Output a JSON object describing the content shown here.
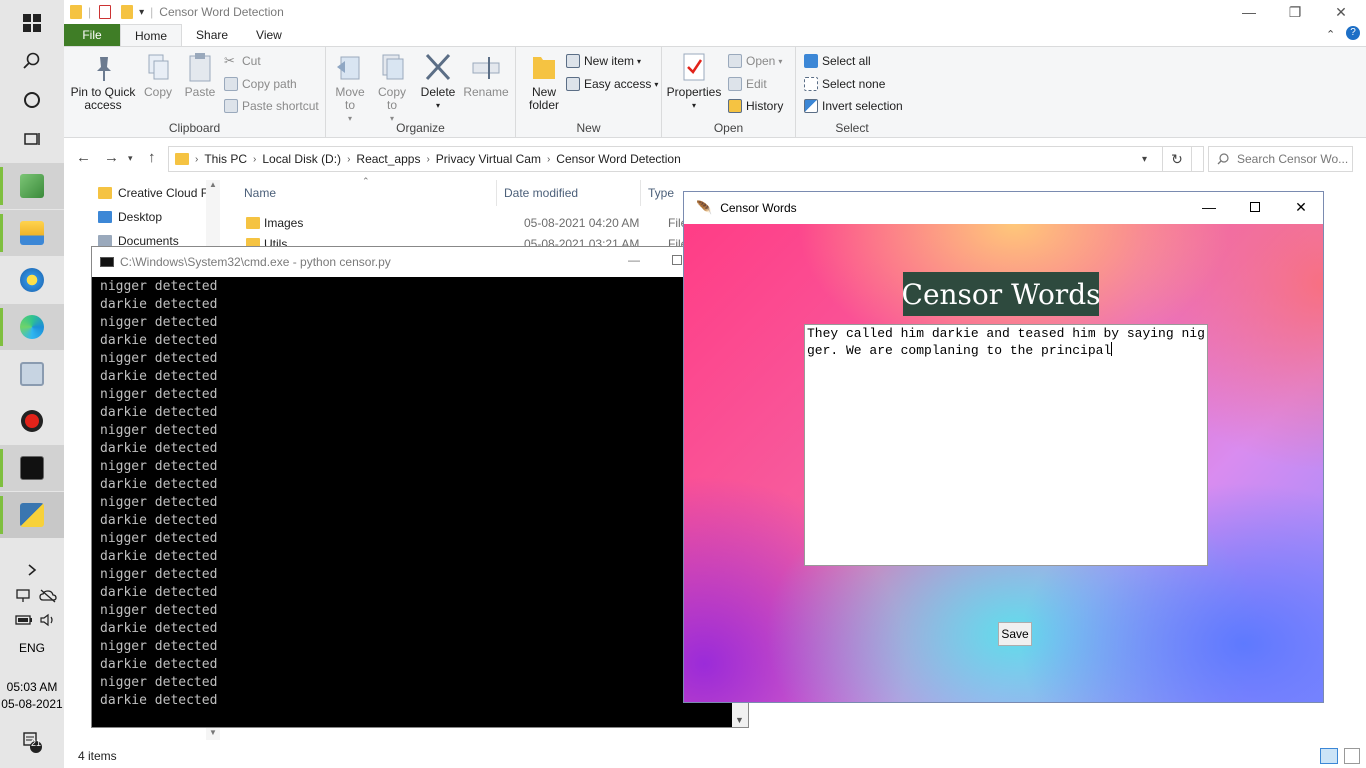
{
  "taskbar": {
    "system": {
      "language": "ENG",
      "time": "05:03 AM",
      "date": "05-08-2021",
      "notification_count": "21"
    }
  },
  "explorer": {
    "title": "Censor Word Detection",
    "tabs": [
      "File",
      "Home",
      "Share",
      "View"
    ],
    "ribbon": {
      "clipboard": {
        "label": "Clipboard",
        "pin": "Pin to Quick access",
        "copy": "Copy",
        "paste": "Paste",
        "cut": "Cut",
        "copy_path": "Copy path",
        "paste_shortcut": "Paste shortcut"
      },
      "organize": {
        "label": "Organize",
        "move_to": "Move to",
        "copy_to": "Copy to",
        "delete": "Delete",
        "rename": "Rename"
      },
      "new": {
        "label": "New",
        "new_folder": "New folder",
        "new_item": "New item",
        "easy_access": "Easy access"
      },
      "open": {
        "label": "Open",
        "properties": "Properties",
        "open": "Open",
        "edit": "Edit",
        "history": "History"
      },
      "select": {
        "label": "Select",
        "select_all": "Select all",
        "select_none": "Select none",
        "invert_selection": "Invert selection"
      }
    },
    "breadcrumb": [
      "This PC",
      "Local Disk (D:)",
      "React_apps",
      "Privacy Virtual Cam",
      "Censor Word Detection"
    ],
    "search_placeholder": "Search Censor Wo...",
    "nav_items": [
      "Creative Cloud F",
      "Desktop",
      "Documents"
    ],
    "columns": {
      "name": "Name",
      "date_modified": "Date modified",
      "type": "Type"
    },
    "files": [
      {
        "name": "Images",
        "date": "05-08-2021 04:20 AM",
        "type": "File fol"
      },
      {
        "name": "Utils",
        "date": "05-08-2021 03:21 AM",
        "type": "File fol"
      }
    ],
    "status": "4 items"
  },
  "cmd": {
    "title": "C:\\Windows\\System32\\cmd.exe - python  censor.py",
    "lines": [
      "nigger detected",
      "darkie detected",
      "nigger detected",
      "darkie detected",
      "nigger detected",
      "darkie detected",
      "nigger detected",
      "darkie detected",
      "nigger detected",
      "darkie detected",
      "nigger detected",
      "darkie detected",
      "nigger detected",
      "darkie detected",
      "nigger detected",
      "darkie detected",
      "nigger detected",
      "darkie detected",
      "nigger detected",
      "darkie detected",
      "nigger detected",
      "darkie detected",
      "nigger detected",
      "darkie detected"
    ]
  },
  "censor_app": {
    "title": "Censor Words",
    "heading": "Censor Words",
    "text": "They called him darkie and teased him by saying nigger. We are complaning to the principal",
    "save": "Save"
  }
}
